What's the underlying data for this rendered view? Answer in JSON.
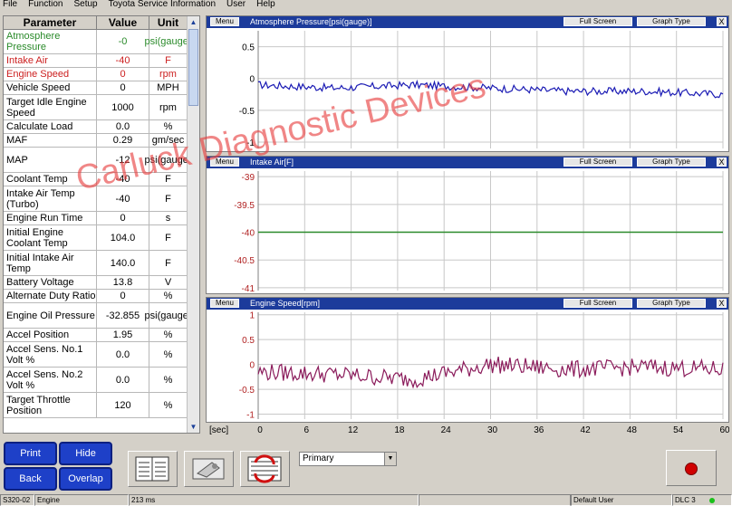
{
  "menu": [
    "File",
    "Function",
    "Setup",
    "Toyota Service Information",
    "User",
    "Help"
  ],
  "table": {
    "headers": {
      "parameter": "Parameter",
      "value": "Value",
      "unit": "Unit"
    },
    "rows": [
      {
        "p": "Atmosphere Pressure",
        "v": "-0",
        "u": "psi(gauge)",
        "color": "#2a8a2a",
        "h": 27
      },
      {
        "p": "Intake Air",
        "v": "-40",
        "u": "F",
        "color": "#cc2020",
        "h": 15
      },
      {
        "p": "Engine Speed",
        "v": "0",
        "u": "rpm",
        "color": "#cc2020",
        "h": 15
      },
      {
        "p": "Vehicle Speed",
        "v": "0",
        "u": "MPH",
        "color": "#000000",
        "h": 15
      },
      {
        "p": "Target Idle Engine Speed",
        "v": "1000",
        "u": "rpm",
        "color": "#000000",
        "h": 28
      },
      {
        "p": "Calculate Load",
        "v": "0.0",
        "u": "%",
        "color": "#000000",
        "h": 15
      },
      {
        "p": "MAF",
        "v": "0.29",
        "u": "gm/sec",
        "color": "#000000",
        "h": 15
      },
      {
        "p": "MAP",
        "v": "-12",
        "u": "psi(gauge)",
        "color": "#000000",
        "h": 28
      },
      {
        "p": "Coolant Temp",
        "v": "-40",
        "u": "F",
        "color": "#000000",
        "h": 15
      },
      {
        "p": "Intake Air Temp (Turbo)",
        "v": "-40",
        "u": "F",
        "color": "#000000",
        "h": 28
      },
      {
        "p": "Engine Run Time",
        "v": "0",
        "u": "s",
        "color": "#000000",
        "h": 15
      },
      {
        "p": "Initial Engine Coolant Temp",
        "v": "104.0",
        "u": "F",
        "color": "#000000",
        "h": 28
      },
      {
        "p": "Initial Intake Air Temp",
        "v": "140.0",
        "u": "F",
        "color": "#000000",
        "h": 28
      },
      {
        "p": "Battery Voltage",
        "v": "13.8",
        "u": "V",
        "color": "#000000",
        "h": 15
      },
      {
        "p": "Alternate Duty Ratio",
        "v": "0",
        "u": "%",
        "color": "#000000",
        "h": 15
      },
      {
        "p": "Engine Oil Pressure",
        "v": "-32.855",
        "u": "psi(gauge)",
        "color": "#000000",
        "h": 28
      },
      {
        "p": "Accel Position",
        "v": "1.95",
        "u": "%",
        "color": "#000000",
        "h": 15
      },
      {
        "p": "Accel Sens. No.1 Volt %",
        "v": "0.0",
        "u": "%",
        "color": "#000000",
        "h": 28
      },
      {
        "p": "Accel Sens. No.2 Volt %",
        "v": "0.0",
        "u": "%",
        "color": "#000000",
        "h": 28
      },
      {
        "p": "Target Throttle Position",
        "v": "120",
        "u": "%",
        "color": "#000000",
        "h": 28
      }
    ]
  },
  "graphs": [
    {
      "title": "Atmosphere Pressure[psi(gauge)]",
      "menu": "Menu",
      "full": "Full Screen",
      "type": "Graph Type",
      "close": "X",
      "ticks": [
        "0.5",
        "0",
        "-0.5",
        "-1"
      ],
      "tickColor": "#000000",
      "line": "#1a1ab4"
    },
    {
      "title": "Intake Air[F]",
      "menu": "Menu",
      "full": "Full Screen",
      "type": "Graph Type",
      "close": "X",
      "ticks": [
        "-39",
        "-39.5",
        "-40",
        "-40.5",
        "-41"
      ],
      "tickColor": "#b02020",
      "line": "#2a8a2a"
    },
    {
      "title": "Engine Speed[rpm]",
      "menu": "Menu",
      "full": "Full Screen",
      "type": "Graph Type",
      "close": "X",
      "ticks": [
        "1",
        "0.5",
        "0",
        "-0.5",
        "-1"
      ],
      "tickColor": "#b02020",
      "line": "#8a1a5a"
    }
  ],
  "xaxis": {
    "unit": "[sec]",
    "ticks": [
      "0",
      "6",
      "12",
      "18",
      "24",
      "30",
      "36",
      "42",
      "48",
      "54",
      "60"
    ]
  },
  "buttons": {
    "print": "Print",
    "hide": "Hide",
    "back": "Back",
    "overlap": "Overlap"
  },
  "select": {
    "value": "Primary"
  },
  "status": {
    "model": "S320-02",
    "system": "Engine",
    "time": "213 ms",
    "user": "Default User",
    "dlc": "DLC 3"
  },
  "watermark": "Carluck Diagnostic Devices",
  "chart_data": [
    {
      "type": "line",
      "title": "Atmosphere Pressure[psi(gauge)]",
      "xlabel": "[sec]",
      "x_range": [
        0,
        60
      ],
      "ylim": [
        -1.1,
        0.75
      ],
      "series": [
        {
          "name": "Atmosphere Pressure",
          "values_desc": "noisy around",
          "x": [
            0,
            10,
            20,
            30,
            40,
            50,
            60
          ],
          "y": [
            -0.1,
            -0.15,
            -0.1,
            -0.15,
            -0.2,
            -0.2,
            -0.25
          ]
        }
      ]
    },
    {
      "type": "line",
      "title": "Intake Air[F]",
      "xlabel": "[sec]",
      "x_range": [
        0,
        60
      ],
      "ylim": [
        -41,
        -39
      ],
      "series": [
        {
          "name": "Intake Air",
          "x": [
            0,
            60
          ],
          "y": [
            -40,
            -40
          ]
        }
      ]
    },
    {
      "type": "line",
      "title": "Engine Speed[rpm]",
      "xlabel": "[sec]",
      "x_range": [
        0,
        60
      ],
      "ylim": [
        -1.1,
        1.1
      ],
      "series": [
        {
          "name": "Engine Speed",
          "x": [
            0,
            10,
            20,
            30,
            40,
            50,
            60
          ],
          "y": [
            -0.15,
            -0.2,
            -0.3,
            0,
            -0.1,
            -0.05,
            -0.1
          ]
        }
      ]
    }
  ]
}
